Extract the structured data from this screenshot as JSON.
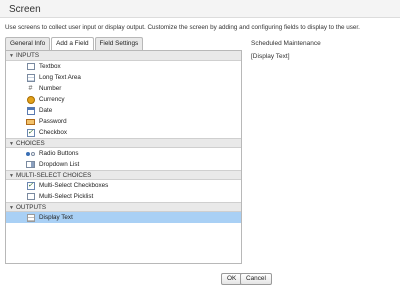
{
  "window": {
    "title": "Screen"
  },
  "description": "Use screens to collect user input or display output. Customize the screen by adding and configuring fields to display to the user.",
  "tabs": [
    {
      "label": "General Info",
      "active": false
    },
    {
      "label": "Add a Field",
      "active": true
    },
    {
      "label": "Field Settings",
      "active": false
    }
  ],
  "sections": {
    "inputs": {
      "label": "INPUTS",
      "items": [
        "Textbox",
        "Long Text Area",
        "Number",
        "Currency",
        "Date",
        "Password",
        "Checkbox"
      ]
    },
    "choices": {
      "label": "CHOICES",
      "items": [
        "Radio Buttons",
        "Dropdown List"
      ]
    },
    "multi": {
      "label": "MULTI-SELECT CHOICES",
      "items": [
        "Multi-Select Checkboxes",
        "Multi-Select Picklist"
      ]
    },
    "outputs": {
      "label": "OUTPUTS",
      "items": [
        "Display Text"
      ]
    }
  },
  "selected_item": "Display Text",
  "preview": {
    "screen_title": "Scheduled Maintenance",
    "display_text": "[Display Text]"
  },
  "buttons": {
    "ok": "OK",
    "cancel": "Cancel"
  },
  "icons": {
    "section_toggle": "chevron-down-icon",
    "Textbox": "textbox-icon",
    "Long Text Area": "long-text-area-icon",
    "Number": "number-hash-icon",
    "Currency": "currency-coin-icon",
    "Date": "calendar-icon",
    "Password": "password-icon",
    "Checkbox": "checkbox-icon",
    "Radio Buttons": "radio-buttons-icon",
    "Dropdown List": "dropdown-list-icon",
    "Multi-Select Checkboxes": "multi-checkbox-icon",
    "Multi-Select Picklist": "picklist-icon",
    "Display Text": "display-text-icon"
  },
  "colors": {
    "selected_row": "#a9d0f5",
    "section_header": "#e9e9e9",
    "titlebar": "#f4f4f4"
  }
}
